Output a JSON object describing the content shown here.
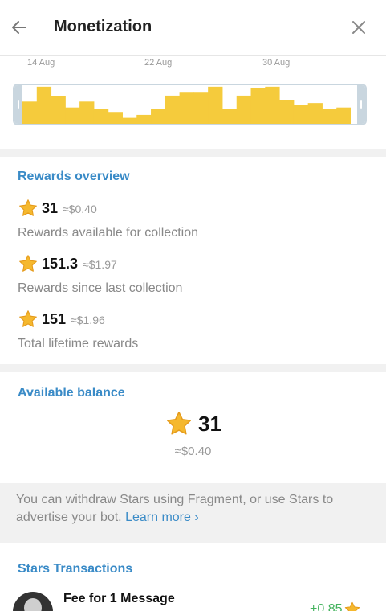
{
  "header": {
    "title": "Monetization",
    "back_icon": "arrow-left-icon",
    "close_icon": "close-icon"
  },
  "chart": {
    "x_labels": [
      "14 Aug",
      "22 Aug",
      "30 Aug"
    ],
    "bar_color": "#f5cb3c"
  },
  "chart_data": {
    "type": "bar",
    "categories": [
      "14 Aug",
      "22 Aug",
      "30 Aug"
    ],
    "values": [
      30,
      50,
      37,
      22,
      30,
      20,
      16,
      8,
      12,
      20,
      38,
      42,
      42,
      50,
      20,
      38,
      48,
      50,
      32,
      25,
      28,
      20,
      22
    ]
  },
  "rewards": {
    "title": "Rewards overview",
    "items": [
      {
        "value": "31",
        "approx": "≈$0.40",
        "label": "Rewards available for collection"
      },
      {
        "value": "151.3",
        "approx": "≈$1.97",
        "label": "Rewards since last collection"
      },
      {
        "value": "151",
        "approx": "≈$1.96",
        "label": "Total lifetime rewards"
      }
    ]
  },
  "balance": {
    "title": "Available balance",
    "value": "31",
    "approx": "≈$0.40"
  },
  "info": {
    "text": "You can withdraw Stars using Fragment, or use Stars to advertise your bot.",
    "link": "Learn more ›"
  },
  "transactions": {
    "title": "Stars Transactions",
    "items": [
      {
        "title": "Fee for 1 Message",
        "amount": "+0.85"
      }
    ]
  },
  "colors": {
    "accent": "#3a8bc7",
    "star": "#f5b82e",
    "positive": "#44b35e"
  }
}
